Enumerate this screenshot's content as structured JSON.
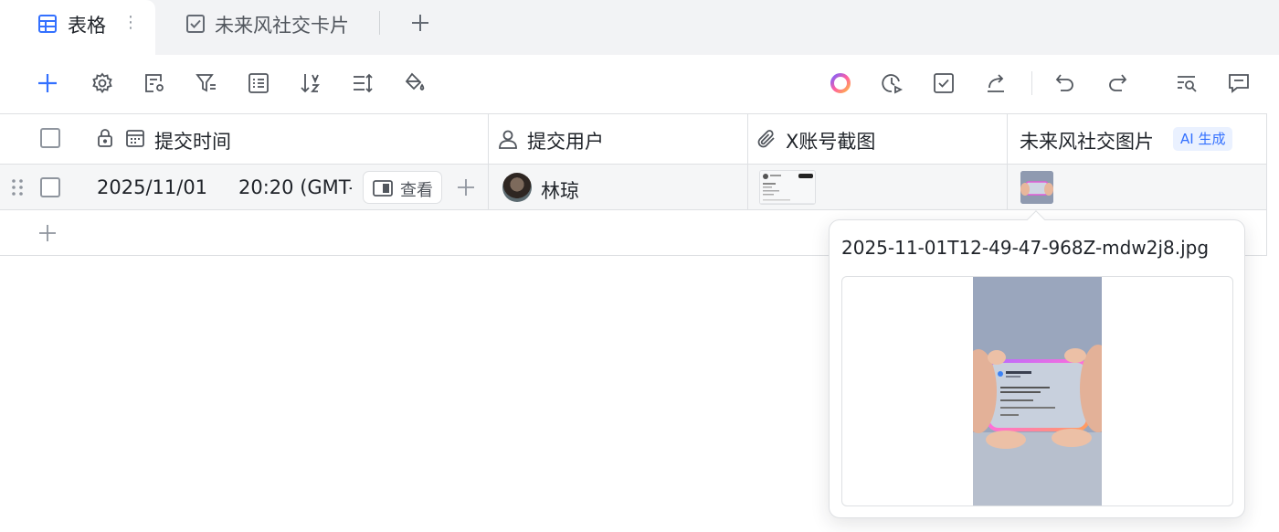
{
  "tabs": [
    {
      "label": "表格",
      "active": true,
      "icon": "grid-table-icon"
    },
    {
      "label": "未来风社交卡片",
      "active": false,
      "icon": "form-check-icon"
    }
  ],
  "tab_more": "⋮",
  "toolbar": {
    "left_icons": [
      "add-icon",
      "settings-icon",
      "field-settings-icon",
      "filter-icon",
      "group-icon",
      "sort-icon",
      "row-height-icon",
      "fill-color-icon"
    ],
    "right_icons": [
      "ai-assistant-icon",
      "history-icon",
      "task-check-icon",
      "share-icon",
      "undo-icon",
      "redo-icon",
      "search-icon",
      "comment-icon"
    ]
  },
  "table": {
    "columns": [
      {
        "label": "提交时间",
        "icon": "calendar-icon",
        "locked": true
      },
      {
        "label": "提交用户",
        "icon": "person-icon"
      },
      {
        "label": "X账号截图",
        "icon": "attachment-icon"
      },
      {
        "label": "未来风社交图片",
        "badge": "AI 生成"
      }
    ],
    "rows": [
      {
        "date": "2025/11/01",
        "time": "20:20 (GMT-",
        "view_label": "查看",
        "user": "林琼"
      }
    ]
  },
  "popover": {
    "filename": "2025-11-01T12-49-47-968Z-mdw2j8.jpg"
  },
  "colors": {
    "accent": "#3370ff",
    "border": "#dee0e3",
    "tabbar": "#f2f3f5"
  }
}
